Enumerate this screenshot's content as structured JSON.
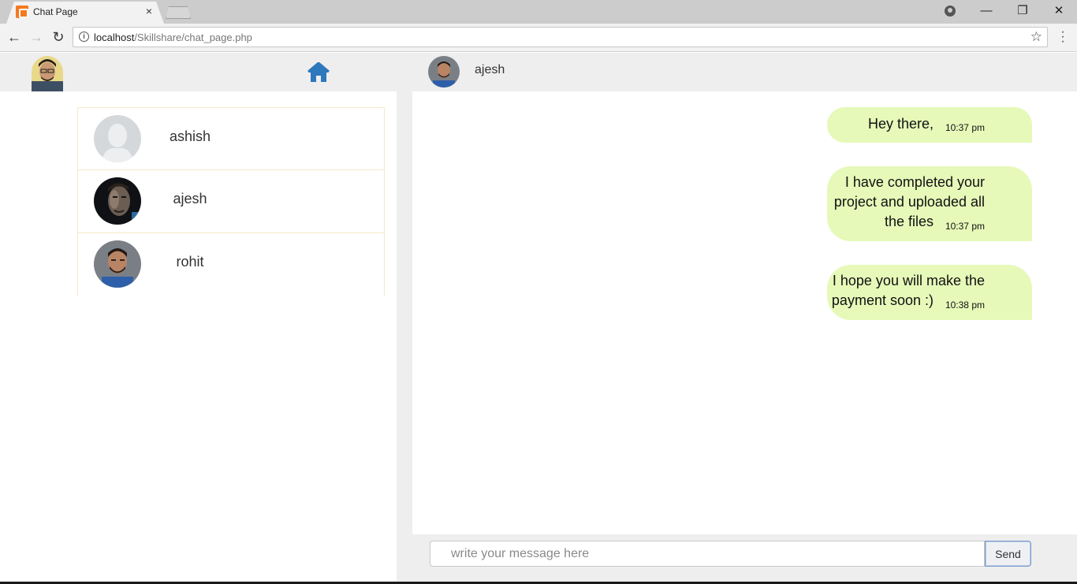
{
  "browser": {
    "tab_title": "Chat Page",
    "tab_close": "×",
    "url_host": "localhost",
    "url_path": "/Skillshare/chat_page.php",
    "window_controls": {
      "minimize": "—",
      "maximize": "❐",
      "close": "✕"
    }
  },
  "header": {
    "current_contact": "ajesh"
  },
  "users": [
    {
      "name": "ashish",
      "avatar": "placeholder-avatar"
    },
    {
      "name": "ajesh",
      "avatar": "dark-portrait-avatar"
    },
    {
      "name": "rohit",
      "avatar": "portrait-avatar"
    }
  ],
  "messages": [
    {
      "lines": [
        "Hey there,"
      ],
      "time": "10:37 pm"
    },
    {
      "lines": [
        "I have completed your",
        "project and uploaded all",
        "the files"
      ],
      "time": "10:37 pm"
    },
    {
      "lines": [
        "I hope you will make the",
        "payment soon :)"
      ],
      "time": "10:38 pm"
    }
  ],
  "composer": {
    "placeholder": "write your message here",
    "send_label": "Send"
  },
  "colors": {
    "bubble": "#e6f9b9",
    "home_icon": "#2e78bd",
    "panel_bg": "#eeeeee"
  }
}
